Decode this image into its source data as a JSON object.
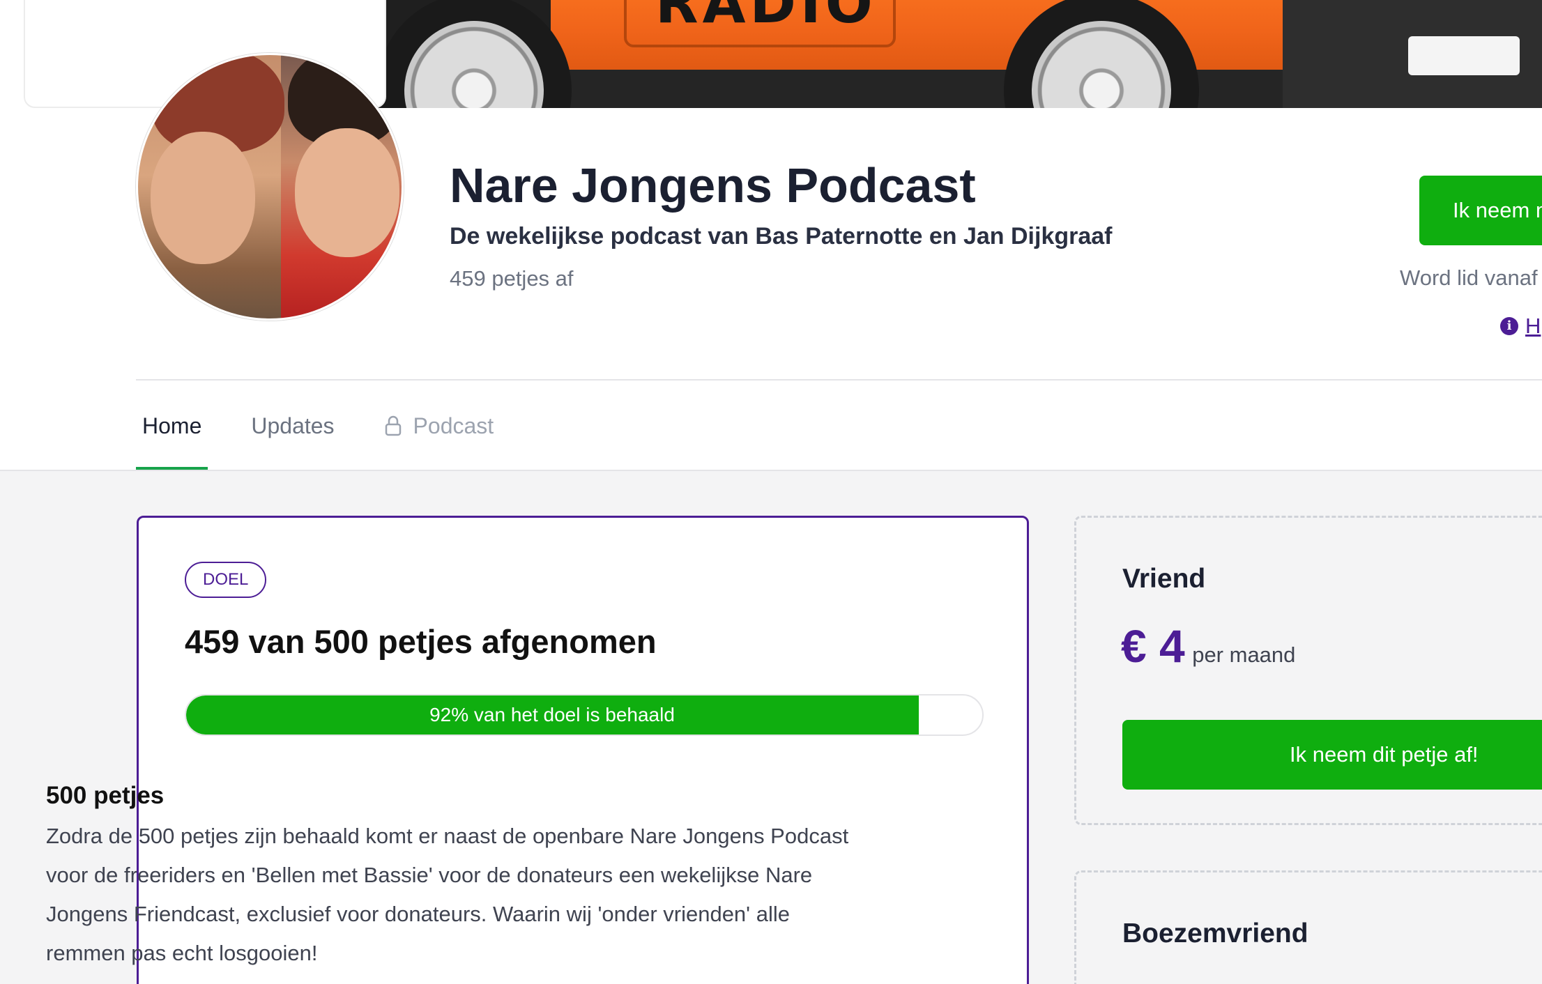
{
  "banner": {
    "text": "RADIO"
  },
  "header": {
    "title": "Nare Jongens Podcast",
    "subtitle": "De wekelijkse podcast van Bas Paternotte en Jan Dijkgraaf",
    "count": "459 petjes af",
    "join_button": "Ik neem m",
    "join_note": "Word lid vanaf",
    "info_link": "H"
  },
  "tabs": [
    {
      "label": "Home",
      "active": true
    },
    {
      "label": "Updates",
      "active": false
    },
    {
      "label": "Podcast",
      "active": false,
      "locked": true,
      "icon": "lock-icon"
    }
  ],
  "goal": {
    "badge": "DOEL",
    "title": "459 van 500 petjes afgenomen",
    "progress_percent": 92,
    "progress_label": "92% van het doel is behaald",
    "subtitle": "500 petjes",
    "description": "Zodra de 500 petjes zijn behaald komt er naast de openbare Nare Jongens Podcast voor de freeriders en 'Bellen met Bassie' voor de donateurs een wekelijkse Nare Jongens Friendcast, exclusief voor donateurs. Waarin wij 'onder vrienden' alle remmen pas echt losgooien!"
  },
  "tiers": [
    {
      "name": "Vriend",
      "price": "€ 4",
      "period": "per maand",
      "button": "Ik neem dit petje af!"
    },
    {
      "name": "Boezemvriend"
    }
  ],
  "colors": {
    "accent_purple": "#4c1d95",
    "accent_green": "#0fae0f",
    "text_dark": "#1b2031",
    "text_muted": "#6b7280"
  }
}
